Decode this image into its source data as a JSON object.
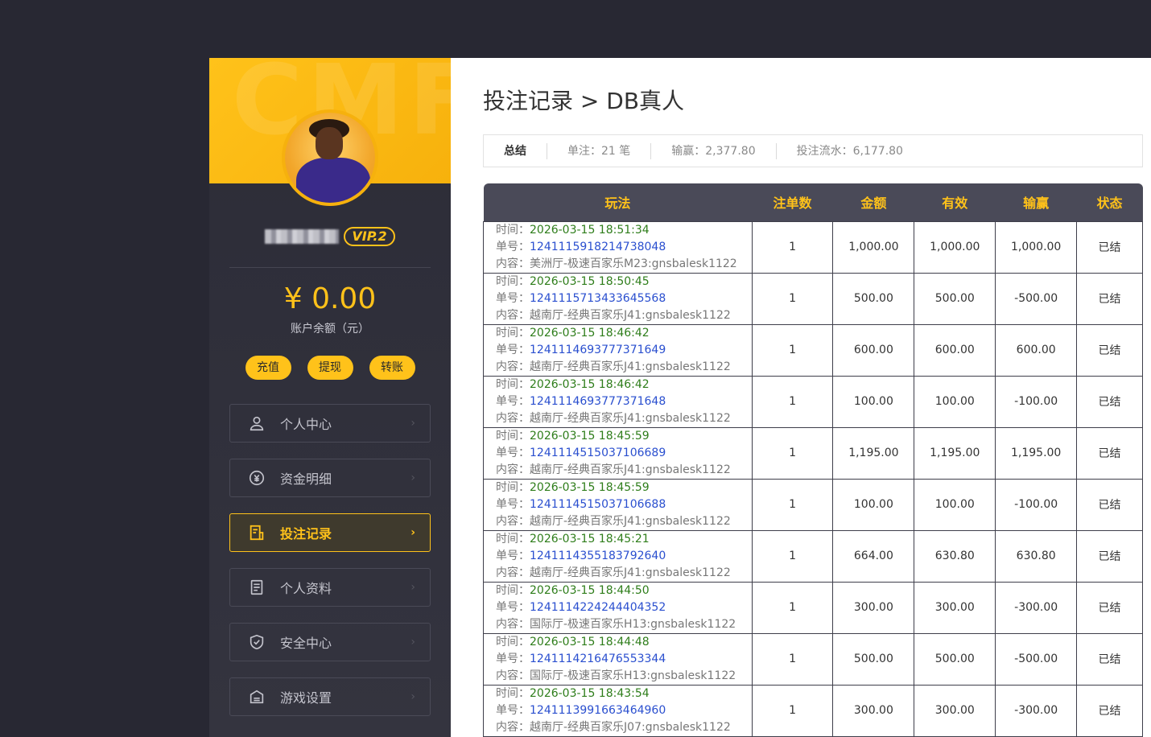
{
  "sidebar": {
    "banner_text": "CMF",
    "vip_label": "VIP.2",
    "balance": "¥ 0.00",
    "balance_label": "账户余额（元）",
    "actions": [
      "充值",
      "提现",
      "转账"
    ],
    "menu": [
      {
        "label": "个人中心",
        "icon": "user-icon"
      },
      {
        "label": "资金明细",
        "icon": "currency-icon"
      },
      {
        "label": "投注记录",
        "icon": "bet-record-icon"
      },
      {
        "label": "个人资料",
        "icon": "profile-doc-icon"
      },
      {
        "label": "安全中心",
        "icon": "shield-icon"
      },
      {
        "label": "游戏设置",
        "icon": "game-settings-icon"
      }
    ],
    "active_index": 2,
    "chevron": "›"
  },
  "main": {
    "title": "投注记录 > DB真人",
    "summary": {
      "label": "总结",
      "count": "单注：21 笔",
      "win_loss": "输赢：2,377.80",
      "turnover": "投注流水：6,177.80"
    },
    "columns": [
      "玩法",
      "注单数",
      "金额",
      "有效",
      "输赢",
      "状态"
    ],
    "labels": {
      "time": "时间：",
      "no": "单号：",
      "content": "内容："
    },
    "rows": [
      {
        "time": "2026-03-15 18:51:34",
        "no": "1241115918214738048",
        "content": "美洲厅-极速百家乐M23:gnsbalesk1122",
        "count": "1",
        "amount": "1,000.00",
        "valid": "1,000.00",
        "result": "1,000.00",
        "status": "已结",
        "win": true
      },
      {
        "time": "2026-03-15 18:50:45",
        "no": "1241115713433645568",
        "content": "越南厅-经典百家乐J41:gnsbalesk1122",
        "count": "1",
        "amount": "500.00",
        "valid": "500.00",
        "result": "-500.00",
        "status": "已结",
        "win": false
      },
      {
        "time": "2026-03-15 18:46:42",
        "no": "1241114693777371649",
        "content": "越南厅-经典百家乐J41:gnsbalesk1122",
        "count": "1",
        "amount": "600.00",
        "valid": "600.00",
        "result": "600.00",
        "status": "已结",
        "win": true
      },
      {
        "time": "2026-03-15 18:46:42",
        "no": "1241114693777371648",
        "content": "越南厅-经典百家乐J41:gnsbalesk1122",
        "count": "1",
        "amount": "100.00",
        "valid": "100.00",
        "result": "-100.00",
        "status": "已结",
        "win": false
      },
      {
        "time": "2026-03-15 18:45:59",
        "no": "1241114515037106689",
        "content": "越南厅-经典百家乐J41:gnsbalesk1122",
        "count": "1",
        "amount": "1,195.00",
        "valid": "1,195.00",
        "result": "1,195.00",
        "status": "已结",
        "win": true
      },
      {
        "time": "2026-03-15 18:45:59",
        "no": "1241114515037106688",
        "content": "越南厅-经典百家乐J41:gnsbalesk1122",
        "count": "1",
        "amount": "100.00",
        "valid": "100.00",
        "result": "-100.00",
        "status": "已结",
        "win": false
      },
      {
        "time": "2026-03-15 18:45:21",
        "no": "1241114355183792640",
        "content": "越南厅-经典百家乐J41:gnsbalesk1122",
        "count": "1",
        "amount": "664.00",
        "valid": "630.80",
        "result": "630.80",
        "status": "已结",
        "win": true
      },
      {
        "time": "2026-03-15 18:44:50",
        "no": "1241114224244404352",
        "content": "国际厅-极速百家乐H13:gnsbalesk1122",
        "count": "1",
        "amount": "300.00",
        "valid": "300.00",
        "result": "-300.00",
        "status": "已结",
        "win": false
      },
      {
        "time": "2026-03-15 18:44:48",
        "no": "1241114216476553344",
        "content": "国际厅-极速百家乐H13:gnsbalesk1122",
        "count": "1",
        "amount": "500.00",
        "valid": "500.00",
        "result": "-500.00",
        "status": "已结",
        "win": false
      },
      {
        "time": "2026-03-15 18:43:54",
        "no": "1241113991663464960",
        "content": "越南厅-经典百家乐J07:gnsbalesk1122",
        "count": "1",
        "amount": "300.00",
        "valid": "300.00",
        "result": "-300.00",
        "status": "已结",
        "win": false
      }
    ]
  },
  "colors": {
    "accent": "#ffc21a",
    "win": "#2e7d1a",
    "loss": "#e0001b",
    "order_no": "#2a4fcf"
  }
}
